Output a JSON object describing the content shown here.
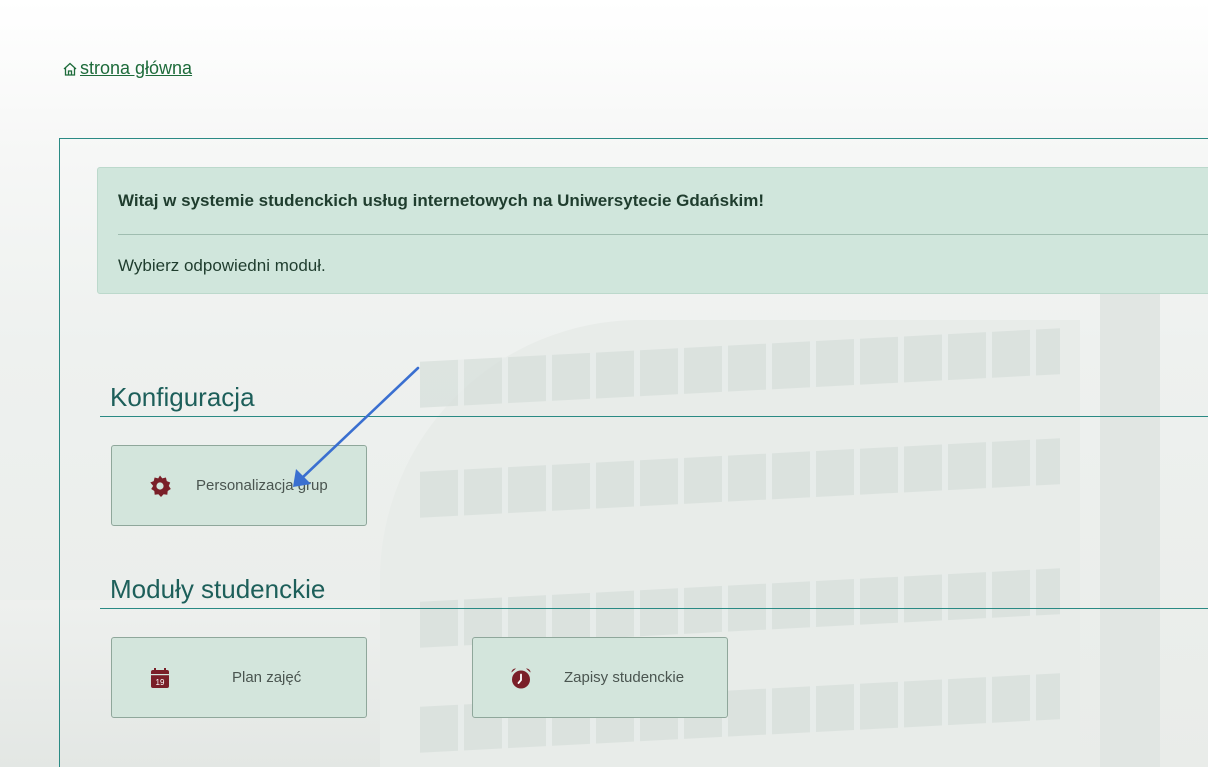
{
  "nav": {
    "home_label": " strona główna"
  },
  "alert": {
    "title": "Witaj w systemie studenckich usług internetowych na Uniwersytecie Gdańskim!",
    "subtitle": "Wybierz odpowiedni moduł."
  },
  "sections": {
    "config": {
      "title": "Konfiguracja",
      "tiles": [
        {
          "label": "Personalizacja grup",
          "icon": "gear-icon"
        }
      ]
    },
    "student": {
      "title": "Moduły studenckie",
      "tiles": [
        {
          "label": "Plan zajęć",
          "icon": "calendar-icon",
          "icon_text": "19"
        },
        {
          "label": "Zapisy studenckie",
          "icon": "alarm-clock-icon"
        }
      ]
    }
  },
  "colors": {
    "accent": "#2a8a84",
    "icon": "#7a1f28",
    "link": "#1d6b3a",
    "arrow": "#3a6fd0"
  }
}
